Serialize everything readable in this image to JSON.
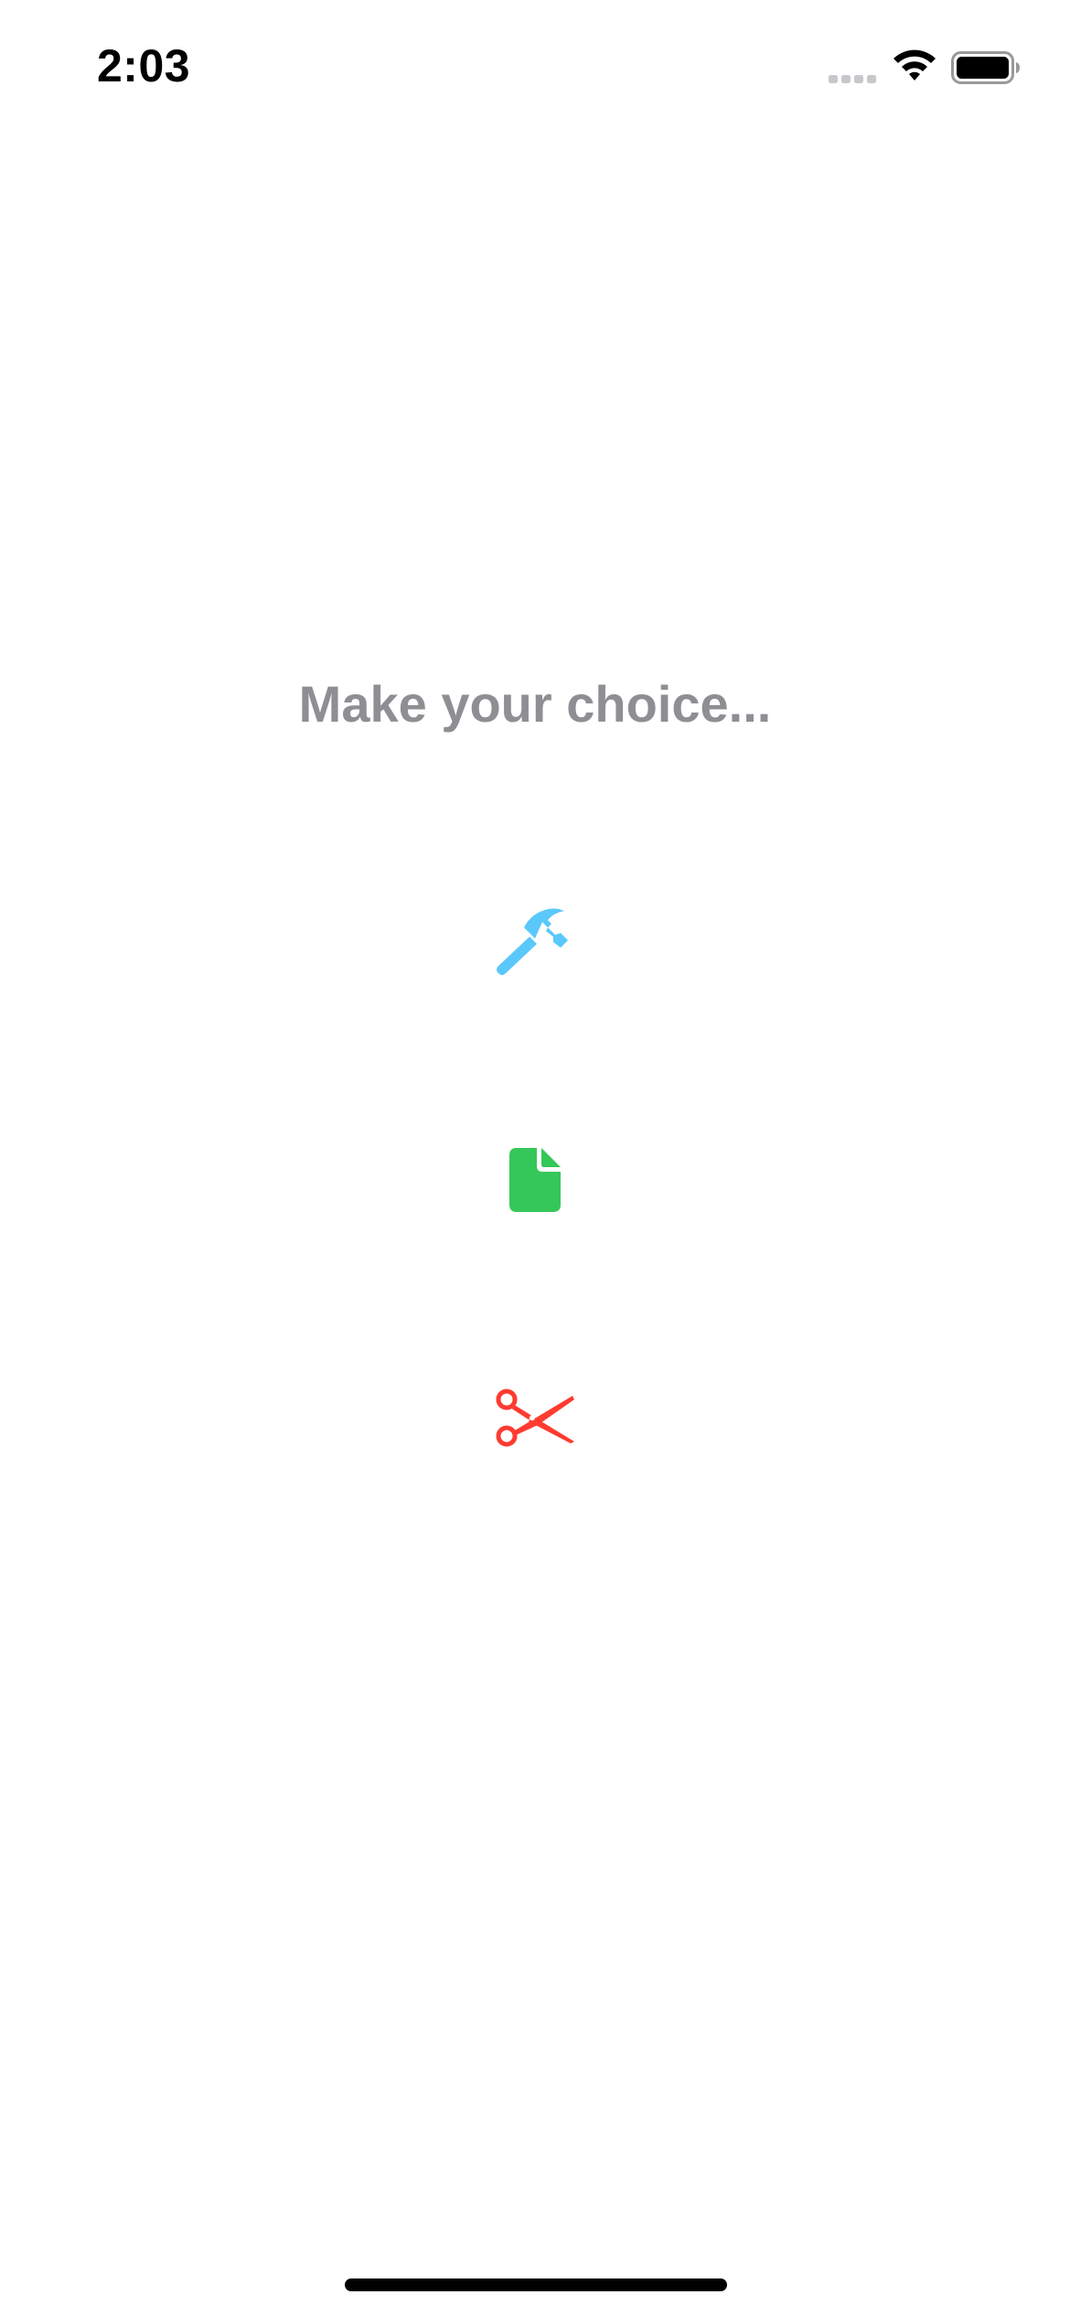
{
  "status_bar": {
    "time": "2:03"
  },
  "prompt": {
    "text": "Make your choice..."
  },
  "choices": [
    {
      "name": "rock",
      "icon": "hammer-icon",
      "color": "#5ac8fa"
    },
    {
      "name": "paper",
      "icon": "document-icon",
      "color": "#34c759"
    },
    {
      "name": "scissors",
      "icon": "scissors-icon",
      "color": "#ff3b30"
    }
  ],
  "colors": {
    "background": "#ffffff",
    "prompt_text": "#8e8e93",
    "status_text": "#000000"
  }
}
